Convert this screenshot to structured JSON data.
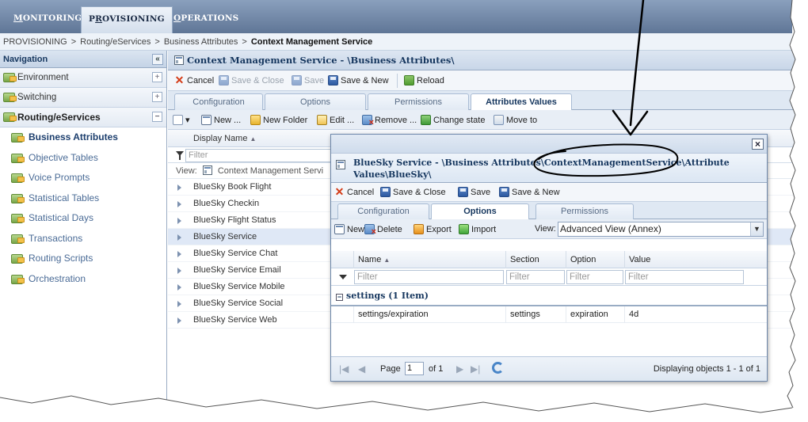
{
  "topnav": {
    "tabs": [
      {
        "label": "MONITORING",
        "underline": "M",
        "rest": "ONITORING"
      },
      {
        "label": "PROVISIONING",
        "pre": "P",
        "underline": "R",
        "rest": "OVISIONING"
      },
      {
        "label": "OPERATIONS",
        "underline": "O",
        "rest": "PERATIONS"
      }
    ]
  },
  "breadcrumb": {
    "items": [
      "PROVISIONING",
      "Routing/eServices",
      "Business Attributes"
    ],
    "current": "Context Management Service",
    "separator": ">"
  },
  "navigation": {
    "title": "Navigation",
    "collapse_glyph": "«",
    "groups": [
      {
        "label": "Environment",
        "toggle": "+"
      },
      {
        "label": "Switching",
        "toggle": "+"
      },
      {
        "label": "Routing/eServices",
        "toggle": "−"
      }
    ],
    "items": [
      {
        "label": "Business Attributes",
        "selected": true
      },
      {
        "label": "Objective Tables"
      },
      {
        "label": "Voice Prompts"
      },
      {
        "label": "Statistical Tables"
      },
      {
        "label": "Statistical Days"
      },
      {
        "label": "Transactions"
      },
      {
        "label": "Routing Scripts"
      },
      {
        "label": "Orchestration"
      }
    ]
  },
  "main": {
    "title": "Context Management Service - \\Business Attributes\\",
    "toolbar": {
      "cancel": "Cancel",
      "save_close": "Save & Close",
      "save": "Save",
      "save_new": "Save & New",
      "reload": "Reload"
    },
    "tabs": [
      "Configuration",
      "Options",
      "Permissions",
      "Attributes Values"
    ],
    "active_tab": "Attributes Values",
    "grid_toolbar": {
      "new": "New ...",
      "new_folder": "New Folder",
      "edit": "Edit ...",
      "remove": "Remove ...",
      "change_state": "Change state",
      "move_to": "Move to"
    },
    "grid": {
      "column": "Display Name",
      "sort_glyph": "▲",
      "filter_placeholder": "Filter",
      "view_label": "View:",
      "view_value": "Context Management Servi",
      "rows": [
        "BlueSky Book Flight",
        "BlueSky Checkin",
        "BlueSky Flight Status",
        "BlueSky Service",
        "BlueSky Service Chat",
        "BlueSky Service Email",
        "BlueSky Service Mobile",
        "BlueSky Service Social",
        "BlueSky Service Web"
      ],
      "selected_row": "BlueSky Service"
    }
  },
  "dialog": {
    "close_glyph": "×",
    "title_prefix": "BlueSky Service - \\Business Attributes\\",
    "title_highlight": "ContextManagementService",
    "title_suffix": "\\Attribute Values\\BlueSky\\",
    "toolbar": {
      "cancel": "Cancel",
      "save_close": "Save & Close",
      "save": "Save",
      "save_new": "Save & New"
    },
    "tabs": [
      "Configuration",
      "Options",
      "Permissions"
    ],
    "active_tab": "Options",
    "grid_toolbar": {
      "new": "New",
      "delete": "Delete",
      "export": "Export",
      "import": "Import",
      "view_label": "View:",
      "view_value": "Advanced View (Annex)"
    },
    "columns": [
      "Name",
      "Section",
      "Option",
      "Value"
    ],
    "sort_glyph": "▲",
    "filter_placeholder": "Filter",
    "group": {
      "label": "settings (1 Item)",
      "toggle": "−"
    },
    "rows": [
      {
        "name": "settings/expiration",
        "section": "settings",
        "option": "expiration",
        "value": "4d"
      }
    ],
    "pager": {
      "page_label": "Page",
      "page_value": "1",
      "of_label": "of 1",
      "display": "Displaying objects 1 - 1 of 1"
    }
  },
  "colors": {
    "topbar": "#6f86a6",
    "accent": "#15365e",
    "link": "#4a6b96",
    "annotation": "#000000"
  }
}
